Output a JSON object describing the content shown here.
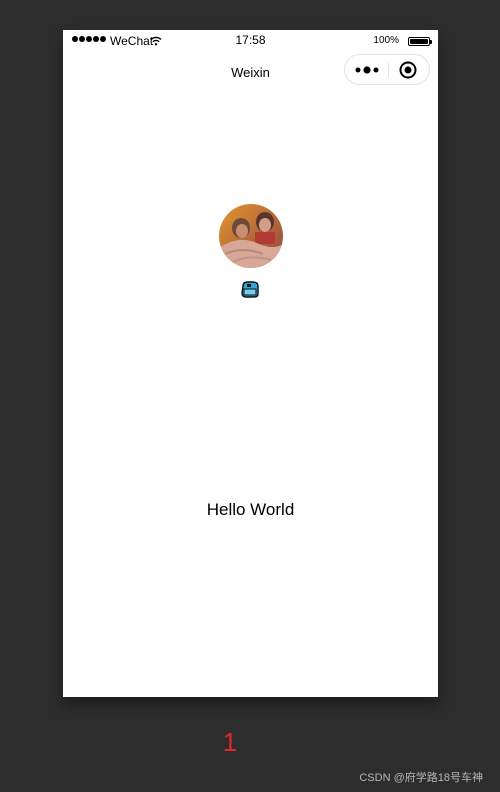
{
  "status_bar": {
    "carrier": "WeChat",
    "time": "17:58",
    "battery_percent": "100%",
    "battery_level": 1.0,
    "signal_icon": "signal-dots-icon",
    "wifi_icon": "wifi-icon"
  },
  "nav": {
    "title": "Weixin",
    "more_icon": "more-dots-icon",
    "close_icon": "target-close-icon"
  },
  "profile": {
    "avatar_icon": "user-avatar-photo",
    "nickname_icon": "emoji-sticker-icon"
  },
  "main": {
    "greeting": "Hello World"
  },
  "footer": {
    "page_number": "1",
    "page_number_color": "#e0262e",
    "watermark": "CSDN @府学路18号车神"
  },
  "colors": {
    "background": "#2d2d2d",
    "screen": "#ffffff"
  }
}
